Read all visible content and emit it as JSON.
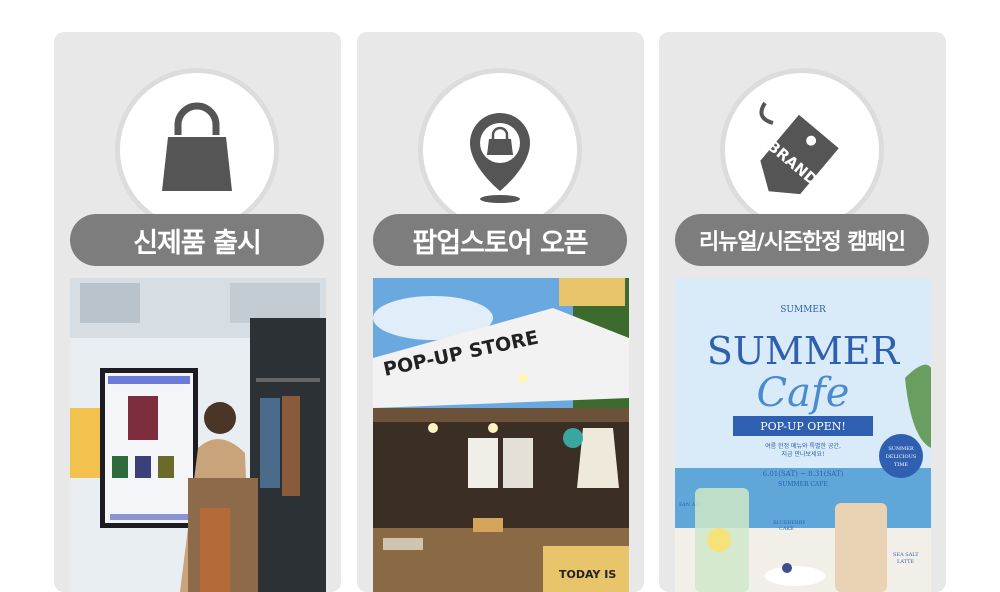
{
  "cards": [
    {
      "title": "신제품 출시",
      "icon": "shopping-bag-icon",
      "photo": "kiosk-store-photo"
    },
    {
      "title": "팝업스토어 오픈",
      "icon": "location-bag-icon",
      "photo": "popup-store-photo",
      "photo_text": {
        "sign": "POP-UP STORE",
        "board": "TODAY IS"
      }
    },
    {
      "title": "리뉴얼/시즌한정 캠페인",
      "icon": "brand-tag-icon",
      "tag_text": "BRAND",
      "photo": "summer-cafe-poster",
      "poster": {
        "top": "SUMMER",
        "headline": "SUMMER",
        "script": "Cafe",
        "banner": "POP-UP OPEN!",
        "line1": "여름 한정 메뉴와 특별한 공간,",
        "line2": "지금 만나보세요!",
        "date": "6.01(SAT) ~ 8.31(SAT)",
        "place": "SUMMER CAFE",
        "badge1": "SUMMER",
        "badge2": "DELICIOUS",
        "badge3": "TIME",
        "left_label": "FAN AIR",
        "cake1": "BLUEBERRY",
        "cake2": "CAKE",
        "right1": "SEA SALT",
        "right2": "LATTE"
      }
    }
  ],
  "colors": {
    "card_bg": "#e8e8e8",
    "pill_bg": "#7d7d7d",
    "icon": "#555555",
    "poster_blue": "#2e5fb0"
  }
}
